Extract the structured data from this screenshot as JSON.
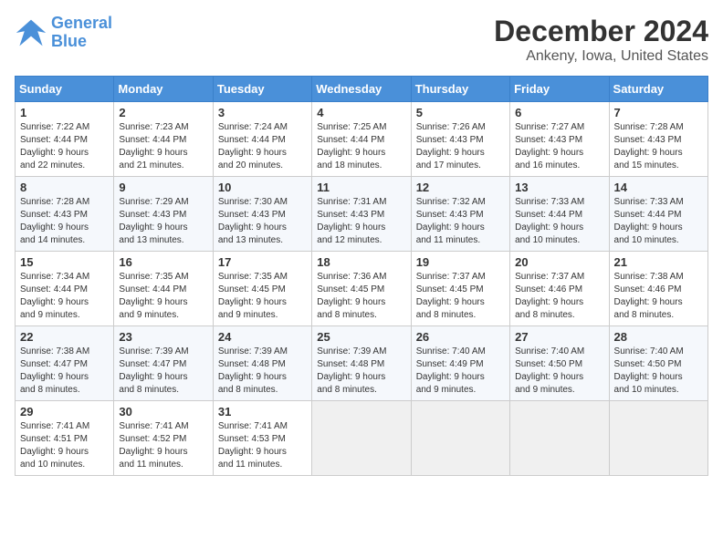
{
  "header": {
    "logo_line1": "General",
    "logo_line2": "Blue",
    "title": "December 2024",
    "subtitle": "Ankeny, Iowa, United States"
  },
  "weekdays": [
    "Sunday",
    "Monday",
    "Tuesday",
    "Wednesday",
    "Thursday",
    "Friday",
    "Saturday"
  ],
  "weeks": [
    [
      {
        "day": "1",
        "sunrise": "7:22 AM",
        "sunset": "4:44 PM",
        "daylight": "9 hours and 22 minutes."
      },
      {
        "day": "2",
        "sunrise": "7:23 AM",
        "sunset": "4:44 PM",
        "daylight": "9 hours and 21 minutes."
      },
      {
        "day": "3",
        "sunrise": "7:24 AM",
        "sunset": "4:44 PM",
        "daylight": "9 hours and 20 minutes."
      },
      {
        "day": "4",
        "sunrise": "7:25 AM",
        "sunset": "4:44 PM",
        "daylight": "9 hours and 18 minutes."
      },
      {
        "day": "5",
        "sunrise": "7:26 AM",
        "sunset": "4:43 PM",
        "daylight": "9 hours and 17 minutes."
      },
      {
        "day": "6",
        "sunrise": "7:27 AM",
        "sunset": "4:43 PM",
        "daylight": "9 hours and 16 minutes."
      },
      {
        "day": "7",
        "sunrise": "7:28 AM",
        "sunset": "4:43 PM",
        "daylight": "9 hours and 15 minutes."
      }
    ],
    [
      {
        "day": "8",
        "sunrise": "7:28 AM",
        "sunset": "4:43 PM",
        "daylight": "9 hours and 14 minutes."
      },
      {
        "day": "9",
        "sunrise": "7:29 AM",
        "sunset": "4:43 PM",
        "daylight": "9 hours and 13 minutes."
      },
      {
        "day": "10",
        "sunrise": "7:30 AM",
        "sunset": "4:43 PM",
        "daylight": "9 hours and 13 minutes."
      },
      {
        "day": "11",
        "sunrise": "7:31 AM",
        "sunset": "4:43 PM",
        "daylight": "9 hours and 12 minutes."
      },
      {
        "day": "12",
        "sunrise": "7:32 AM",
        "sunset": "4:43 PM",
        "daylight": "9 hours and 11 minutes."
      },
      {
        "day": "13",
        "sunrise": "7:33 AM",
        "sunset": "4:44 PM",
        "daylight": "9 hours and 10 minutes."
      },
      {
        "day": "14",
        "sunrise": "7:33 AM",
        "sunset": "4:44 PM",
        "daylight": "9 hours and 10 minutes."
      }
    ],
    [
      {
        "day": "15",
        "sunrise": "7:34 AM",
        "sunset": "4:44 PM",
        "daylight": "9 hours and 9 minutes."
      },
      {
        "day": "16",
        "sunrise": "7:35 AM",
        "sunset": "4:44 PM",
        "daylight": "9 hours and 9 minutes."
      },
      {
        "day": "17",
        "sunrise": "7:35 AM",
        "sunset": "4:45 PM",
        "daylight": "9 hours and 9 minutes."
      },
      {
        "day": "18",
        "sunrise": "7:36 AM",
        "sunset": "4:45 PM",
        "daylight": "9 hours and 8 minutes."
      },
      {
        "day": "19",
        "sunrise": "7:37 AM",
        "sunset": "4:45 PM",
        "daylight": "9 hours and 8 minutes."
      },
      {
        "day": "20",
        "sunrise": "7:37 AM",
        "sunset": "4:46 PM",
        "daylight": "9 hours and 8 minutes."
      },
      {
        "day": "21",
        "sunrise": "7:38 AM",
        "sunset": "4:46 PM",
        "daylight": "9 hours and 8 minutes."
      }
    ],
    [
      {
        "day": "22",
        "sunrise": "7:38 AM",
        "sunset": "4:47 PM",
        "daylight": "9 hours and 8 minutes."
      },
      {
        "day": "23",
        "sunrise": "7:39 AM",
        "sunset": "4:47 PM",
        "daylight": "9 hours and 8 minutes."
      },
      {
        "day": "24",
        "sunrise": "7:39 AM",
        "sunset": "4:48 PM",
        "daylight": "9 hours and 8 minutes."
      },
      {
        "day": "25",
        "sunrise": "7:39 AM",
        "sunset": "4:48 PM",
        "daylight": "9 hours and 8 minutes."
      },
      {
        "day": "26",
        "sunrise": "7:40 AM",
        "sunset": "4:49 PM",
        "daylight": "9 hours and 9 minutes."
      },
      {
        "day": "27",
        "sunrise": "7:40 AM",
        "sunset": "4:50 PM",
        "daylight": "9 hours and 9 minutes."
      },
      {
        "day": "28",
        "sunrise": "7:40 AM",
        "sunset": "4:50 PM",
        "daylight": "9 hours and 10 minutes."
      }
    ],
    [
      {
        "day": "29",
        "sunrise": "7:41 AM",
        "sunset": "4:51 PM",
        "daylight": "9 hours and 10 minutes."
      },
      {
        "day": "30",
        "sunrise": "7:41 AM",
        "sunset": "4:52 PM",
        "daylight": "9 hours and 11 minutes."
      },
      {
        "day": "31",
        "sunrise": "7:41 AM",
        "sunset": "4:53 PM",
        "daylight": "9 hours and 11 minutes."
      },
      null,
      null,
      null,
      null
    ]
  ],
  "labels": {
    "sunrise": "Sunrise: ",
    "sunset": "Sunset: ",
    "daylight": "Daylight hours"
  }
}
